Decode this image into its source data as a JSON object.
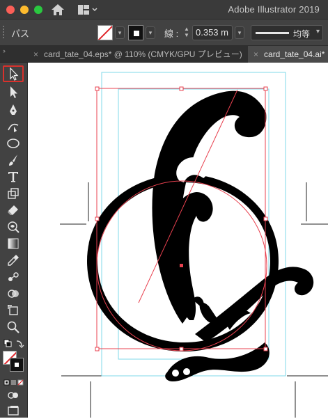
{
  "window": {
    "app_title": "Adobe Illustrator 2019"
  },
  "control_bar": {
    "object_type": "パス",
    "stroke_label": "線 :",
    "stroke_weight": "0.353 m",
    "stroke_profile": "均等"
  },
  "tabs": [
    {
      "label": "card_tate_04.eps* @ 110% (CMYK/GPU プレビュー)",
      "active": false
    },
    {
      "label": "card_tate_04.ai*",
      "active": true
    }
  ],
  "tools": [
    {
      "icon": "selection-tool-icon",
      "active": true
    },
    {
      "icon": "direct-selection-tool-icon",
      "active": false
    },
    {
      "icon": "pen-tool-icon",
      "active": false
    },
    {
      "icon": "curvature-tool-icon",
      "active": false
    },
    {
      "icon": "ellipse-tool-icon",
      "active": false
    },
    {
      "icon": "paintbrush-tool-icon",
      "active": false
    },
    {
      "icon": "type-tool-icon",
      "active": false
    },
    {
      "icon": "scale-tool-icon",
      "active": false
    },
    {
      "icon": "eraser-tool-icon",
      "active": false
    },
    {
      "icon": "warp-tool-icon",
      "active": false
    },
    {
      "icon": "gradient-tool-icon",
      "active": false
    },
    {
      "icon": "eyedropper-tool-icon",
      "active": false
    },
    {
      "icon": "blend-tool-icon",
      "active": false
    },
    {
      "icon": "shape-builder-tool-icon",
      "active": false
    },
    {
      "icon": "artboard-tool-icon",
      "active": false
    },
    {
      "icon": "zoom-tool-icon",
      "active": false
    }
  ],
  "colors": {
    "selection": "#e8414f",
    "guide": "#7fd8e8",
    "artwork": "#000000",
    "ui_dark": "#424242"
  }
}
